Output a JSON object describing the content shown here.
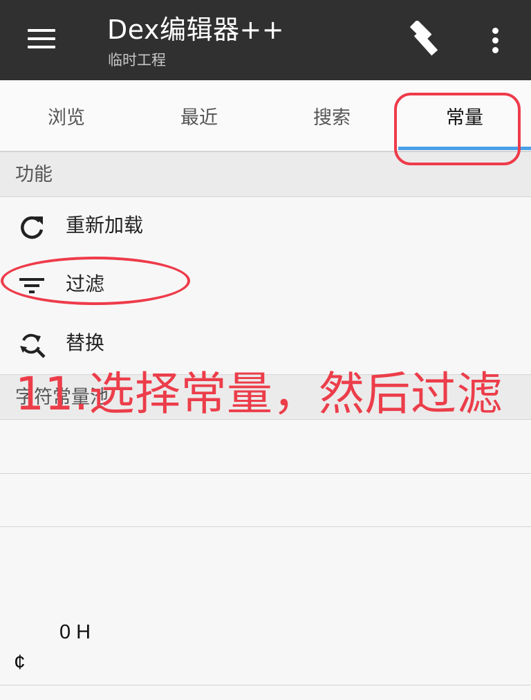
{
  "appbar": {
    "title": "Dex编辑器++",
    "subtitle": "临时工程",
    "menu_icon": "menu-icon",
    "build_icon": "hammer-icon",
    "more_icon": "more-vert-icon"
  },
  "tabs": [
    {
      "label": "浏览"
    },
    {
      "label": "最近"
    },
    {
      "label": "搜索"
    },
    {
      "label": "常量",
      "active": true
    }
  ],
  "sections": {
    "functions_header": "功能",
    "pool_header": "字符常量池"
  },
  "function_items": [
    {
      "label": "重新加载",
      "icon": "refresh-icon"
    },
    {
      "label": "过滤",
      "icon": "filter-icon"
    },
    {
      "label": "替换",
      "icon": "find-replace-icon"
    }
  ],
  "pool_rows": {
    "row4_text": "0 H",
    "row4_symbol": "¢"
  },
  "annotation": {
    "text": "11.选择常量，然后过滤",
    "color": "#ec3d4a"
  },
  "colors": {
    "appbar": "#303030",
    "tab_indicator": "#4aa0e6",
    "annotation": "#ec3d4a"
  }
}
